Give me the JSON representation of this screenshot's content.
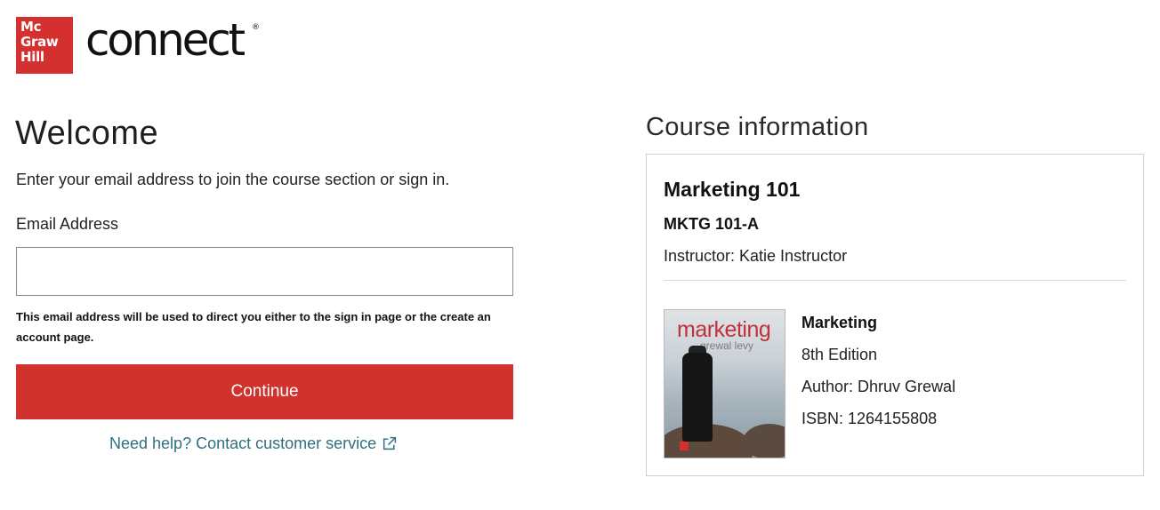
{
  "header": {
    "logo_lines": [
      "Mc",
      "Graw",
      "Hill"
    ],
    "brand": "connect",
    "registered_mark": "®"
  },
  "colors": {
    "brand_red": "#d3302f",
    "button_red": "#d0322e",
    "link_teal": "#2f6f82"
  },
  "welcome": {
    "title": "Welcome",
    "intro": "Enter your email address to join the course section or sign in.",
    "email_label": "Email Address",
    "email_value": "",
    "hint": "This email address will be used to direct you either to the sign in page or the create an account page.",
    "continue_label": "Continue",
    "help_text": "Need help? Contact customer service",
    "help_icon": "external-link-icon"
  },
  "course": {
    "heading": "Course information",
    "title": "Marketing 101",
    "section": "MKTG 101-A",
    "instructor": "Instructor: Katie Instructor",
    "book": {
      "cover_title": "marketing",
      "cover_authors": "grewal levy",
      "title": "Marketing",
      "edition": "8th Edition",
      "author": "Author: Dhruv Grewal",
      "isbn": "ISBN: 1264155808"
    }
  }
}
